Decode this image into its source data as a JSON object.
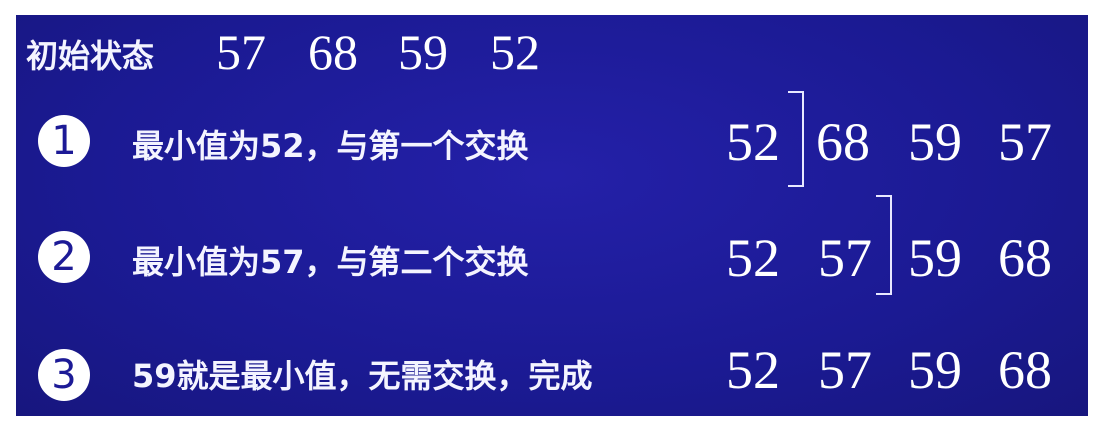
{
  "initial": {
    "label": "初始状态",
    "values": [
      "57",
      "68",
      "59",
      "52"
    ]
  },
  "steps": [
    {
      "marker": "1",
      "text": "最小值为52，与第一个交换",
      "values": [
        "52",
        "68",
        "59",
        "57"
      ]
    },
    {
      "marker": "2",
      "text": "最小值为57，与第二个交换",
      "values": [
        "52",
        "57",
        "59",
        "68"
      ]
    },
    {
      "marker": "3",
      "text": "59就是最小值，无需交换，完成",
      "values": [
        "52",
        "57",
        "59",
        "68"
      ]
    }
  ],
  "colors": {
    "background": "#1c1a96",
    "text": "#ffffff"
  }
}
